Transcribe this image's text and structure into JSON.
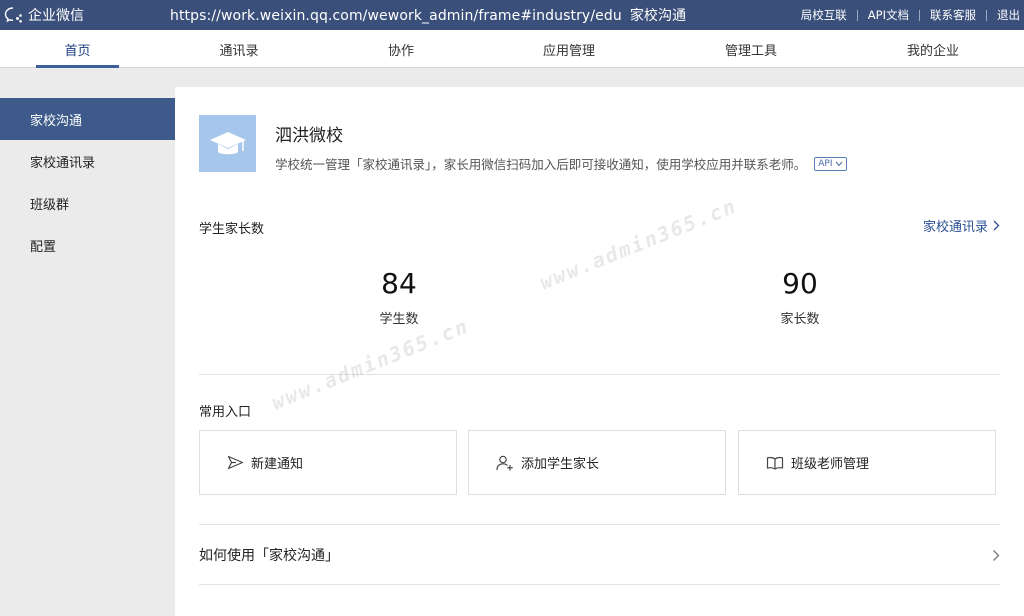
{
  "topbar": {
    "brand": "企业微信",
    "url": "https://work.weixin.qq.com/wework_admin/frame#industry/edu",
    "page_label": "家校沟通",
    "links": [
      "局校互联",
      "API文档",
      "联系客服",
      "退出"
    ]
  },
  "nav": {
    "items": [
      "首页",
      "通讯录",
      "协作",
      "应用管理",
      "管理工具",
      "我的企业"
    ],
    "active": "首页"
  },
  "sidebar": {
    "items": [
      "家校沟通",
      "家校通讯录",
      "班级群",
      "配置"
    ],
    "active": "家校沟通"
  },
  "school": {
    "name": "泗洪微校",
    "description": "学校统一管理「家校通讯录」，家长用微信扫码加入后即可接收通知，使用学校应用并联系老师。",
    "api_badge": "API"
  },
  "stats": {
    "section_title": "学生家长数",
    "contacts_link": "家校通讯录",
    "students": {
      "value": "84",
      "label": "学生数"
    },
    "parents": {
      "value": "90",
      "label": "家长数"
    }
  },
  "entries": {
    "section_title": "常用入口",
    "items": [
      "新建通知",
      "添加学生家长",
      "班级老师管理"
    ]
  },
  "howto": {
    "label": "如何使用「家校沟通」"
  },
  "watermark": "www.admin365.cn",
  "colors": {
    "topbar": "#3a4f7a",
    "sidebar_active": "#3d5a8a",
    "link": "#2a5096",
    "school_icon_bg": "#a7c6ec"
  }
}
